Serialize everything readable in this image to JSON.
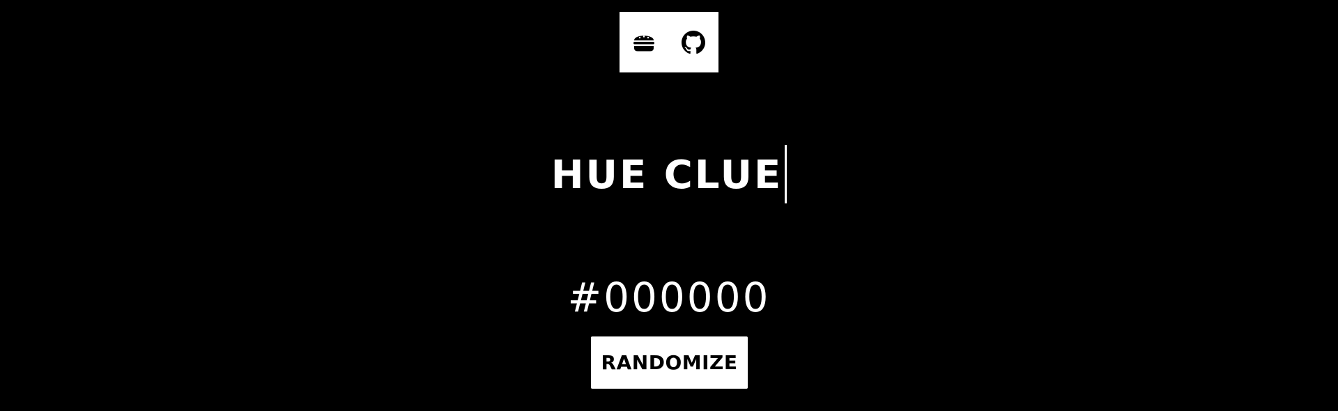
{
  "header": {
    "menu_icon": "hamburger-icon",
    "github_icon": "github-icon"
  },
  "title": "HUE CLUE",
  "color": {
    "hex": "#000000"
  },
  "randomize_label": "RANDOMIZE",
  "colors": {
    "background": "#000000",
    "foreground": "#ffffff"
  }
}
